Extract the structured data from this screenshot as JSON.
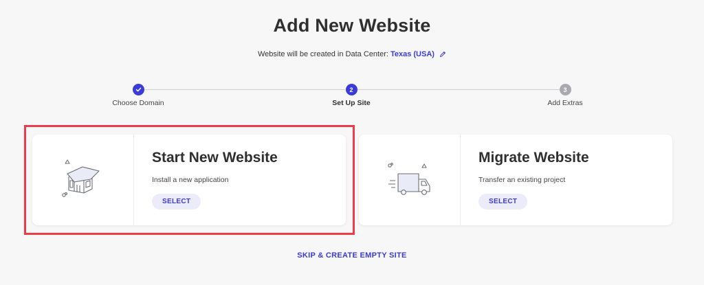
{
  "header": {
    "title": "Add New Website",
    "subtitle_prefix": "Website will be created in Data Center: ",
    "data_center": "Texas (USA)",
    "edit_icon": "pencil-icon"
  },
  "stepper": {
    "steps": [
      {
        "label": "Choose Domain",
        "number": "",
        "state": "done"
      },
      {
        "label": "Set Up Site",
        "number": "2",
        "state": "active"
      },
      {
        "label": "Add Extras",
        "number": "3",
        "state": "future"
      }
    ]
  },
  "cards": [
    {
      "title": "Start New Website",
      "description": "Install a new application",
      "button": "SELECT",
      "icon": "house-icon",
      "highlighted": true
    },
    {
      "title": "Migrate Website",
      "description": "Transfer an existing project",
      "button": "SELECT",
      "icon": "truck-icon",
      "highlighted": false
    }
  ],
  "footer": {
    "skip_label": "SKIP & CREATE EMPTY SITE"
  },
  "colors": {
    "accent": "#3b3bd9",
    "highlight_border": "#ec3d4a",
    "button_bg": "#ecebfa",
    "background": "#f7f7f8"
  }
}
